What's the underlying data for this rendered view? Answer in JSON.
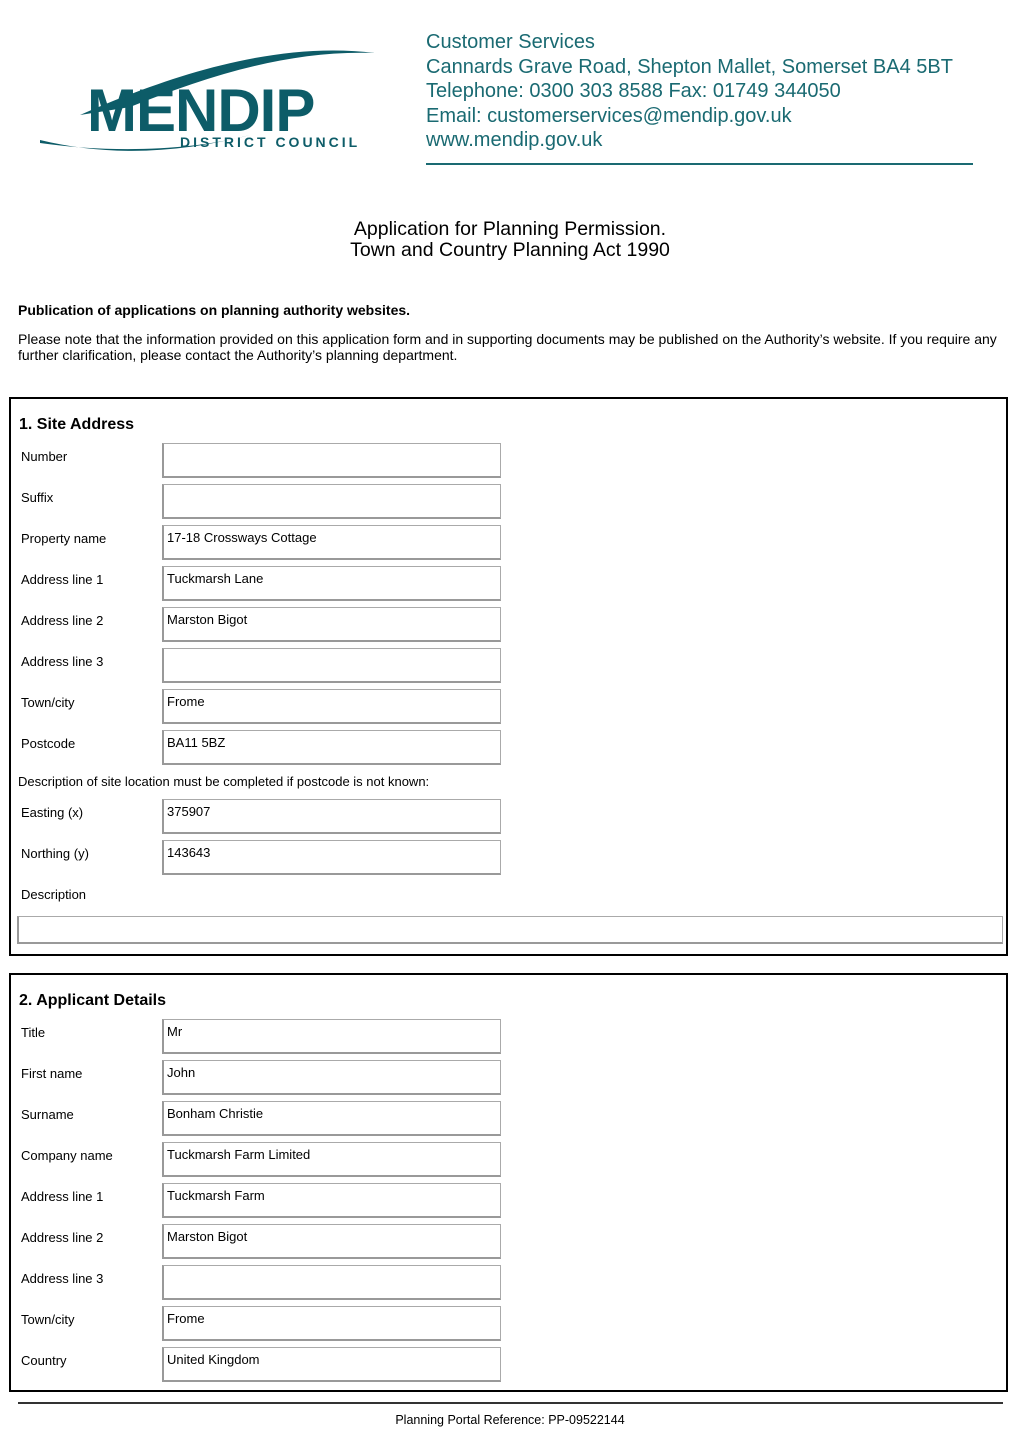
{
  "header": {
    "logo": {
      "name": "MENDIP",
      "subname": "DISTRICT COUNCIL",
      "brand_color": "#0d5c68"
    },
    "contact": {
      "line1": "Customer Services",
      "line2": "Cannards Grave Road, Shepton Mallet, Somerset BA4 5BT",
      "line3": "Telephone: 0300 303 8588 Fax: 01749 344050",
      "line4": "Email: customerservices@mendip.gov.uk",
      "line5": "www.mendip.gov.uk",
      "color": "#1a6a72"
    }
  },
  "title": {
    "line1": "Application for Planning Permission.",
    "line2": "Town and Country Planning Act 1990"
  },
  "publication": {
    "heading": "Publication of applications on planning authority websites.",
    "text": "Please note that the information provided on this application form and in supporting documents may be published on the Authority’s website. If you require any further clarification, please contact the Authority’s planning department."
  },
  "site_address": {
    "title": "1. Site Address",
    "fields": [
      {
        "label": "Number",
        "value": ""
      },
      {
        "label": "Suffix",
        "value": ""
      },
      {
        "label": "Property name",
        "value": "17-18 Crossways Cottage"
      },
      {
        "label": "Address line 1",
        "value": "Tuckmarsh Lane"
      },
      {
        "label": "Address line 2",
        "value": "Marston Bigot"
      },
      {
        "label": "Address line 3",
        "value": ""
      },
      {
        "label": "Town/city",
        "value": "Frome"
      },
      {
        "label": "Postcode",
        "value": "BA11 5BZ"
      }
    ],
    "location_note": "Description of site location must be completed if postcode is not known:",
    "coords": [
      {
        "label": "Easting (x)",
        "value": "375907"
      },
      {
        "label": "Northing (y)",
        "value": "143643"
      }
    ],
    "description_label": "Description",
    "description_value": ""
  },
  "applicant": {
    "title": "2. Applicant Details",
    "fields": [
      {
        "label": "Title",
        "value": "Mr"
      },
      {
        "label": "First name",
        "value": "John"
      },
      {
        "label": "Surname",
        "value": "Bonham Christie"
      },
      {
        "label": "Company name",
        "value": "Tuckmarsh Farm Limited"
      },
      {
        "label": "Address line 1",
        "value": "Tuckmarsh Farm"
      },
      {
        "label": "Address line 2",
        "value": "Marston Bigot"
      },
      {
        "label": "Address line 3",
        "value": ""
      },
      {
        "label": "Town/city",
        "value": "Frome"
      },
      {
        "label": "Country",
        "value": "United Kingdom"
      }
    ]
  },
  "footer": {
    "reference": "Planning Portal Reference: PP-09522144"
  }
}
